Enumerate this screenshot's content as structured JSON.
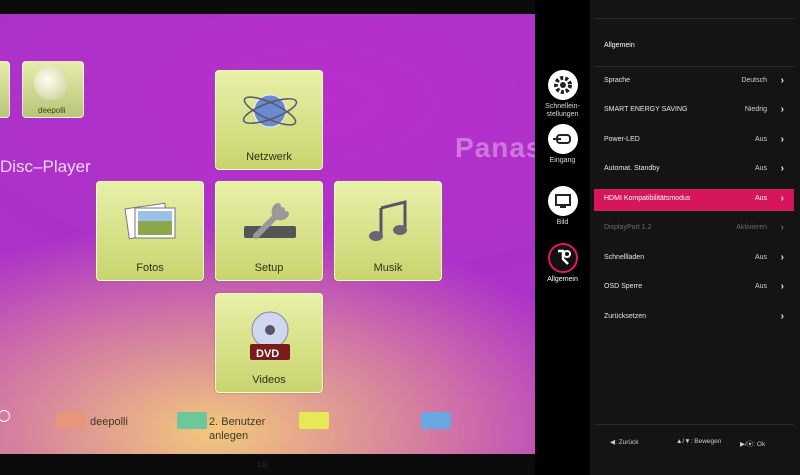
{
  "player": {
    "brand": "Panas",
    "disc_title": "Disc–Player",
    "thumb_label": "deepolli",
    "tiles": {
      "netzwerk": "Netzwerk",
      "fotos": "Fotos",
      "setup": "Setup",
      "musik": "Musik",
      "videos": "Videos",
      "dvd": "DVD"
    },
    "color_buttons": [
      {
        "color": "#e8967a",
        "label": "deepolli"
      },
      {
        "color": "#6cc89a",
        "label": "2. Benutzer anlegen"
      },
      {
        "color": "#e6e858",
        "label": ""
      },
      {
        "color": "#6aa6e0",
        "label": ""
      }
    ]
  },
  "osd": {
    "icons": [
      {
        "name": "gear-icon",
        "label_line1": "Schnellein-",
        "label_line2": "stellungen"
      },
      {
        "name": "input-icon",
        "label_line1": "Eingang",
        "label_line2": ""
      },
      {
        "name": "picture-icon",
        "label_line1": "Bild",
        "label_line2": ""
      },
      {
        "name": "general-settings-icon",
        "label_line1": "Allgemein",
        "label_line2": ""
      }
    ],
    "header": "Allgemein",
    "items": [
      {
        "name": "Sprache",
        "value": "Deutsch"
      },
      {
        "name": "SMART ENERGY SAVING",
        "value": "Niedrig"
      },
      {
        "name": "Power-LED",
        "value": "Aus"
      },
      {
        "name": "Automat. Standby",
        "value": "Aus"
      },
      {
        "name": "HDMI Kompatibilitätsmodus",
        "value": "Aus"
      },
      {
        "name": "DisplayPort 1.2",
        "value": "Aktivieren"
      },
      {
        "name": "Schnellladen",
        "value": "Aus"
      },
      {
        "name": "OSD Sperre",
        "value": "Aus"
      },
      {
        "name": "Zurücksetzen",
        "value": ""
      }
    ],
    "selected_index": 4,
    "disabled_index": 5,
    "footer": {
      "back": "◀: Zurück",
      "move": "▲/▼: Bewegen",
      "ok": "▶/⦿: Ok"
    },
    "accent_color": "#d6165a"
  },
  "bottom_logo": "LG"
}
